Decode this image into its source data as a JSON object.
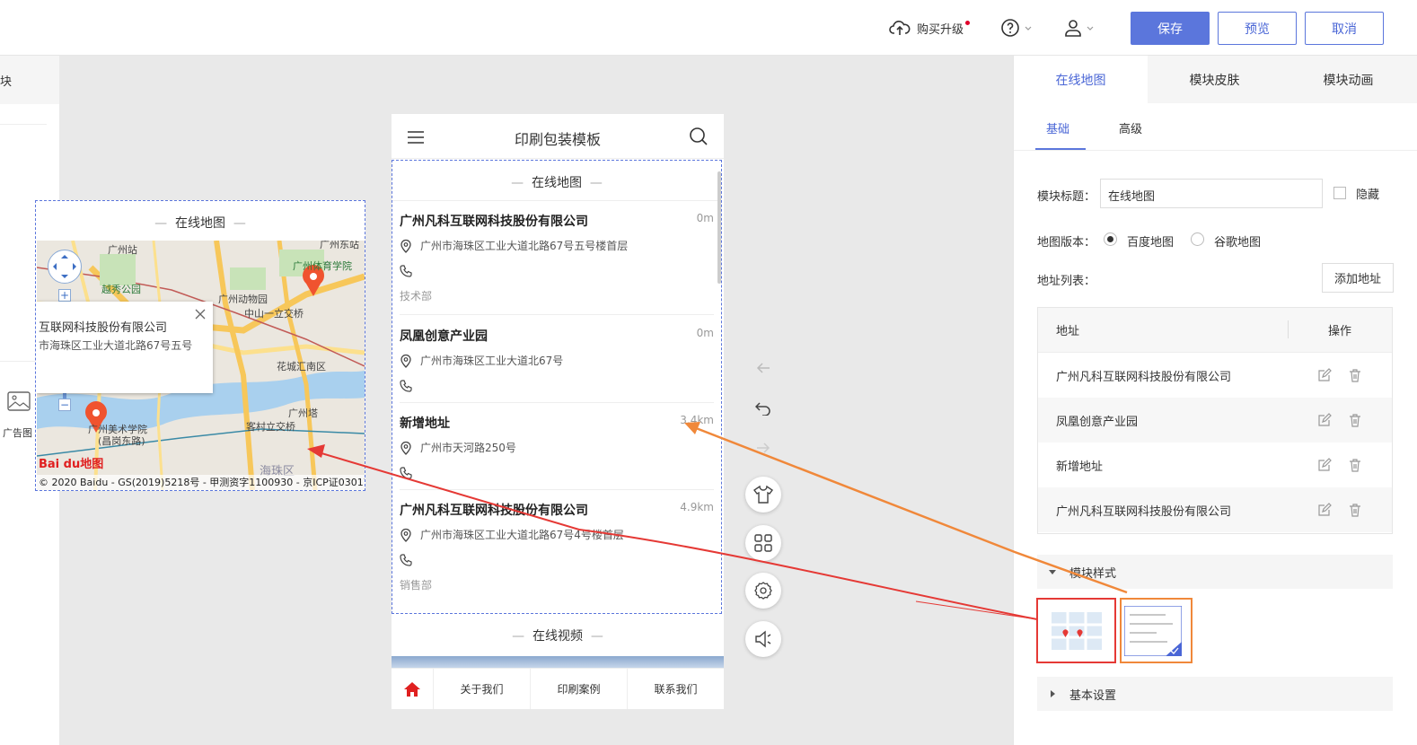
{
  "topbar": {
    "upgrade_label": "购买升级",
    "save_label": "保存",
    "preview_label": "预览",
    "cancel_label": "取消"
  },
  "leftpanel": {
    "partial_tab": "块",
    "ad_image_label": "广告图"
  },
  "phone": {
    "title": "印刷包装模板",
    "map_section_title": "在线地图",
    "video_section_title": "在线视频",
    "addresses": [
      {
        "name": "广州凡科互联网科技股份有限公司",
        "distance": "0m",
        "address": "广州市海珠区工业大道北路67号五号楼首层",
        "dept": "技术部"
      },
      {
        "name": "凤凰创意产业园",
        "distance": "0m",
        "address": "广州市海珠区工业大道北67号",
        "dept": ""
      },
      {
        "name": "新增地址",
        "distance": "3.4km",
        "address": "广州市天河路250号",
        "dept": ""
      },
      {
        "name": "广州凡科互联网科技股份有限公司",
        "distance": "4.9km",
        "address": "广州市海珠区工业大道北路67号4号楼首层",
        "dept": "销售部"
      }
    ],
    "tabbar": [
      "关于我们",
      "印刷案例",
      "联系我们"
    ]
  },
  "map_preview": {
    "title": "在线地图",
    "popup_line1": "互联网科技股份有限公司",
    "popup_line2": "市海珠区工业大道北路67号五号",
    "places": [
      "广州站",
      "广州东站",
      "越秀公园",
      "广州体育学院",
      "广州动物园",
      "中山一立交桥",
      "花城汇南区",
      "广州塔",
      "广州美术学院",
      "(昌岗东路)",
      "客村立交桥",
      "海珠区"
    ],
    "logo": "Bai du地图",
    "copyright": "© 2020 Baidu - GS(2019)5218号 - 甲测资字1100930 - 京ICP证03017"
  },
  "right": {
    "tabs": [
      "在线地图",
      "模块皮肤",
      "模块动画"
    ],
    "subtabs": [
      "基础",
      "高级"
    ],
    "module_title_label": "模块标题：",
    "module_title_value": "在线地图",
    "hide_label": "隐藏",
    "map_version_label": "地图版本：",
    "map_options": [
      "百度地图",
      "谷歌地图"
    ],
    "address_list_label": "地址列表：",
    "add_address_label": "添加地址",
    "table_header_address": "地址",
    "table_header_action": "操作",
    "table_rows": [
      "广州凡科互联网科技股份有限公司",
      "凤凰创意产业园",
      "新增地址",
      "广州凡科互联网科技股份有限公司"
    ],
    "module_style_label": "模块样式",
    "basic_settings_label": "基本设置"
  },
  "colors": {
    "accent": "#5b76dc",
    "red_arrow": "#e53935",
    "orange_arrow": "#f0883a"
  }
}
